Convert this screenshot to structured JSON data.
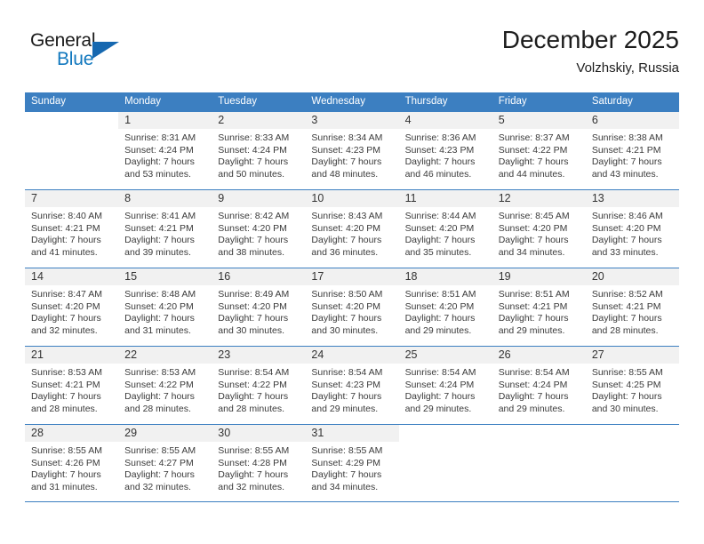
{
  "brand": {
    "name_top": "General",
    "name_bottom": "Blue",
    "accent_color": "#1668b0",
    "text_color": "#1a1a1a"
  },
  "header": {
    "title": "December 2025",
    "subtitle": "Volzhskiy, Russia"
  },
  "theme": {
    "header_row_bg": "#3c7fc1",
    "header_row_text": "#ffffff",
    "day_number_band_bg": "#f1f1f1",
    "grid_line": "#3c7fc1",
    "body_text": "#3a3a3a"
  },
  "weekday_headers": [
    "Sunday",
    "Monday",
    "Tuesday",
    "Wednesday",
    "Thursday",
    "Friday",
    "Saturday"
  ],
  "weeks": [
    [
      {
        "day": "",
        "blank": true,
        "sunrise": "",
        "sunset": "",
        "daylight_line1": "",
        "daylight_line2": ""
      },
      {
        "day": "1",
        "sunrise": "Sunrise: 8:31 AM",
        "sunset": "Sunset: 4:24 PM",
        "daylight_line1": "Daylight: 7 hours",
        "daylight_line2": "and 53 minutes."
      },
      {
        "day": "2",
        "sunrise": "Sunrise: 8:33 AM",
        "sunset": "Sunset: 4:24 PM",
        "daylight_line1": "Daylight: 7 hours",
        "daylight_line2": "and 50 minutes."
      },
      {
        "day": "3",
        "sunrise": "Sunrise: 8:34 AM",
        "sunset": "Sunset: 4:23 PM",
        "daylight_line1": "Daylight: 7 hours",
        "daylight_line2": "and 48 minutes."
      },
      {
        "day": "4",
        "sunrise": "Sunrise: 8:36 AM",
        "sunset": "Sunset: 4:23 PM",
        "daylight_line1": "Daylight: 7 hours",
        "daylight_line2": "and 46 minutes."
      },
      {
        "day": "5",
        "sunrise": "Sunrise: 8:37 AM",
        "sunset": "Sunset: 4:22 PM",
        "daylight_line1": "Daylight: 7 hours",
        "daylight_line2": "and 44 minutes."
      },
      {
        "day": "6",
        "sunrise": "Sunrise: 8:38 AM",
        "sunset": "Sunset: 4:21 PM",
        "daylight_line1": "Daylight: 7 hours",
        "daylight_line2": "and 43 minutes."
      }
    ],
    [
      {
        "day": "7",
        "sunrise": "Sunrise: 8:40 AM",
        "sunset": "Sunset: 4:21 PM",
        "daylight_line1": "Daylight: 7 hours",
        "daylight_line2": "and 41 minutes."
      },
      {
        "day": "8",
        "sunrise": "Sunrise: 8:41 AM",
        "sunset": "Sunset: 4:21 PM",
        "daylight_line1": "Daylight: 7 hours",
        "daylight_line2": "and 39 minutes."
      },
      {
        "day": "9",
        "sunrise": "Sunrise: 8:42 AM",
        "sunset": "Sunset: 4:20 PM",
        "daylight_line1": "Daylight: 7 hours",
        "daylight_line2": "and 38 minutes."
      },
      {
        "day": "10",
        "sunrise": "Sunrise: 8:43 AM",
        "sunset": "Sunset: 4:20 PM",
        "daylight_line1": "Daylight: 7 hours",
        "daylight_line2": "and 36 minutes."
      },
      {
        "day": "11",
        "sunrise": "Sunrise: 8:44 AM",
        "sunset": "Sunset: 4:20 PM",
        "daylight_line1": "Daylight: 7 hours",
        "daylight_line2": "and 35 minutes."
      },
      {
        "day": "12",
        "sunrise": "Sunrise: 8:45 AM",
        "sunset": "Sunset: 4:20 PM",
        "daylight_line1": "Daylight: 7 hours",
        "daylight_line2": "and 34 minutes."
      },
      {
        "day": "13",
        "sunrise": "Sunrise: 8:46 AM",
        "sunset": "Sunset: 4:20 PM",
        "daylight_line1": "Daylight: 7 hours",
        "daylight_line2": "and 33 minutes."
      }
    ],
    [
      {
        "day": "14",
        "sunrise": "Sunrise: 8:47 AM",
        "sunset": "Sunset: 4:20 PM",
        "daylight_line1": "Daylight: 7 hours",
        "daylight_line2": "and 32 minutes."
      },
      {
        "day": "15",
        "sunrise": "Sunrise: 8:48 AM",
        "sunset": "Sunset: 4:20 PM",
        "daylight_line1": "Daylight: 7 hours",
        "daylight_line2": "and 31 minutes."
      },
      {
        "day": "16",
        "sunrise": "Sunrise: 8:49 AM",
        "sunset": "Sunset: 4:20 PM",
        "daylight_line1": "Daylight: 7 hours",
        "daylight_line2": "and 30 minutes."
      },
      {
        "day": "17",
        "sunrise": "Sunrise: 8:50 AM",
        "sunset": "Sunset: 4:20 PM",
        "daylight_line1": "Daylight: 7 hours",
        "daylight_line2": "and 30 minutes."
      },
      {
        "day": "18",
        "sunrise": "Sunrise: 8:51 AM",
        "sunset": "Sunset: 4:20 PM",
        "daylight_line1": "Daylight: 7 hours",
        "daylight_line2": "and 29 minutes."
      },
      {
        "day": "19",
        "sunrise": "Sunrise: 8:51 AM",
        "sunset": "Sunset: 4:21 PM",
        "daylight_line1": "Daylight: 7 hours",
        "daylight_line2": "and 29 minutes."
      },
      {
        "day": "20",
        "sunrise": "Sunrise: 8:52 AM",
        "sunset": "Sunset: 4:21 PM",
        "daylight_line1": "Daylight: 7 hours",
        "daylight_line2": "and 28 minutes."
      }
    ],
    [
      {
        "day": "21",
        "sunrise": "Sunrise: 8:53 AM",
        "sunset": "Sunset: 4:21 PM",
        "daylight_line1": "Daylight: 7 hours",
        "daylight_line2": "and 28 minutes."
      },
      {
        "day": "22",
        "sunrise": "Sunrise: 8:53 AM",
        "sunset": "Sunset: 4:22 PM",
        "daylight_line1": "Daylight: 7 hours",
        "daylight_line2": "and 28 minutes."
      },
      {
        "day": "23",
        "sunrise": "Sunrise: 8:54 AM",
        "sunset": "Sunset: 4:22 PM",
        "daylight_line1": "Daylight: 7 hours",
        "daylight_line2": "and 28 minutes."
      },
      {
        "day": "24",
        "sunrise": "Sunrise: 8:54 AM",
        "sunset": "Sunset: 4:23 PM",
        "daylight_line1": "Daylight: 7 hours",
        "daylight_line2": "and 29 minutes."
      },
      {
        "day": "25",
        "sunrise": "Sunrise: 8:54 AM",
        "sunset": "Sunset: 4:24 PM",
        "daylight_line1": "Daylight: 7 hours",
        "daylight_line2": "and 29 minutes."
      },
      {
        "day": "26",
        "sunrise": "Sunrise: 8:54 AM",
        "sunset": "Sunset: 4:24 PM",
        "daylight_line1": "Daylight: 7 hours",
        "daylight_line2": "and 29 minutes."
      },
      {
        "day": "27",
        "sunrise": "Sunrise: 8:55 AM",
        "sunset": "Sunset: 4:25 PM",
        "daylight_line1": "Daylight: 7 hours",
        "daylight_line2": "and 30 minutes."
      }
    ],
    [
      {
        "day": "28",
        "sunrise": "Sunrise: 8:55 AM",
        "sunset": "Sunset: 4:26 PM",
        "daylight_line1": "Daylight: 7 hours",
        "daylight_line2": "and 31 minutes."
      },
      {
        "day": "29",
        "sunrise": "Sunrise: 8:55 AM",
        "sunset": "Sunset: 4:27 PM",
        "daylight_line1": "Daylight: 7 hours",
        "daylight_line2": "and 32 minutes."
      },
      {
        "day": "30",
        "sunrise": "Sunrise: 8:55 AM",
        "sunset": "Sunset: 4:28 PM",
        "daylight_line1": "Daylight: 7 hours",
        "daylight_line2": "and 32 minutes."
      },
      {
        "day": "31",
        "sunrise": "Sunrise: 8:55 AM",
        "sunset": "Sunset: 4:29 PM",
        "daylight_line1": "Daylight: 7 hours",
        "daylight_line2": "and 34 minutes."
      },
      {
        "day": "",
        "blank": true,
        "sunrise": "",
        "sunset": "",
        "daylight_line1": "",
        "daylight_line2": ""
      },
      {
        "day": "",
        "blank": true,
        "sunrise": "",
        "sunset": "",
        "daylight_line1": "",
        "daylight_line2": ""
      },
      {
        "day": "",
        "blank": true,
        "sunrise": "",
        "sunset": "",
        "daylight_line1": "",
        "daylight_line2": ""
      }
    ]
  ]
}
